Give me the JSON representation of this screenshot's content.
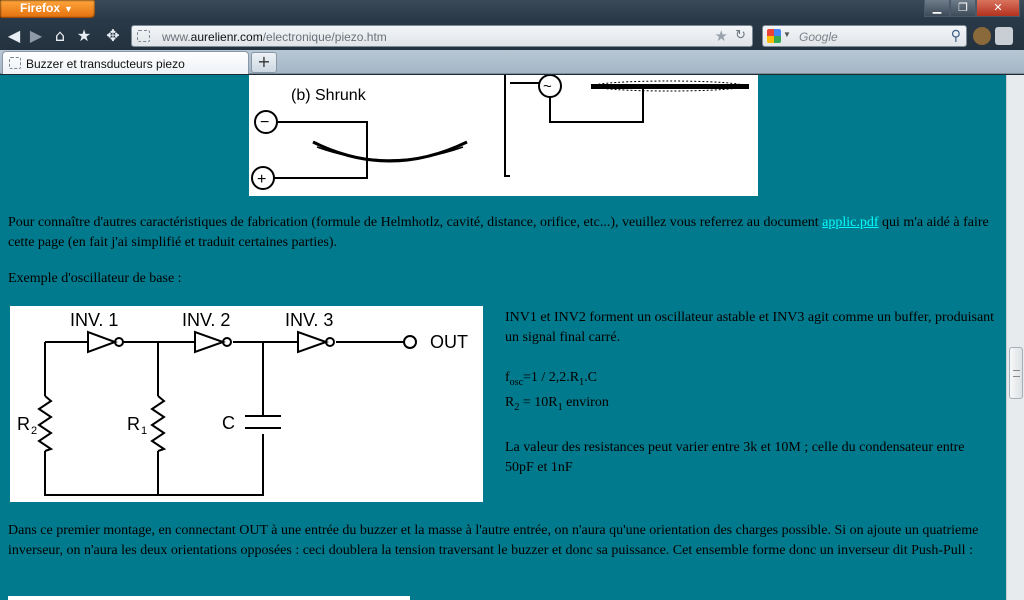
{
  "browser": {
    "app_button": "Firefox",
    "url_domain": "aurelienr.com",
    "url_path": "/electronique/piezo.htm",
    "url_prefix": "www.",
    "search_placeholder": "Google",
    "tab_title": "Buzzer et transducteurs piezo",
    "new_tab_label": "+",
    "window_controls": [
      "minimize",
      "maximize",
      "close"
    ]
  },
  "content": {
    "figure_piezo": {
      "caption": "(b) Shrunk",
      "minus_symbol": "−",
      "plus_symbol": "+",
      "ac_symbol": "~"
    },
    "paragraph_1_before_link": "Pour connaître d'autres caractéristiques de fabrication (formule de Helmhotlz, cavité, distance, orifice, etc...), veuillez vous referrez au document ",
    "paragraph_1_link": "applic.pdf",
    "paragraph_1_after_link": " qui m'a aidé à faire cette page (en fait j'ai simplifié et traduit certaines parties).",
    "paragraph_2": "Exemple d'oscillateur de base :",
    "figure_osc": {
      "inv1": "INV. 1",
      "inv2": "INV. 2",
      "inv3": "INV. 3",
      "out": "OUT",
      "r2": "R",
      "r2_sub": "2",
      "r1": "R",
      "r1_sub": "1",
      "c": "C"
    },
    "osc_desc_1": "INV1 et INV2 forment un oscillateur astable et INV3 agit comme un buffer, produisant un signal final carré.",
    "formula_1_pre": "f",
    "formula_1_sub": "osc",
    "formula_1_mid": "=1 / 2,2.R",
    "formula_1_sub2": "1",
    "formula_1_post": ".C",
    "formula_2_pre": "R",
    "formula_2_sub": "2",
    "formula_2_mid": " = 10R",
    "formula_2_sub2": "1",
    "formula_2_post": " environ",
    "osc_desc_2": "La valeur des resistances peut varier entre 3k et 10M ; celle du condensateur entre 50pF et 1nF",
    "paragraph_3": "Dans ce premier montage, en connectant OUT à une entrée du buzzer et la masse à l'autre entrée, on n'aura qu'une orientation des charges possible. Si on ajoute un quatrieme inverseur, on n'aura les deux orientations opposées : ceci doublera la tension traversant le buzzer et donc sa puissance. Cet ensemble forme donc un inverseur dit Push-Pull :"
  },
  "colors": {
    "page_background": "#007a8c",
    "link": "#00ffff",
    "firefox_orange": "#e36f0c"
  }
}
